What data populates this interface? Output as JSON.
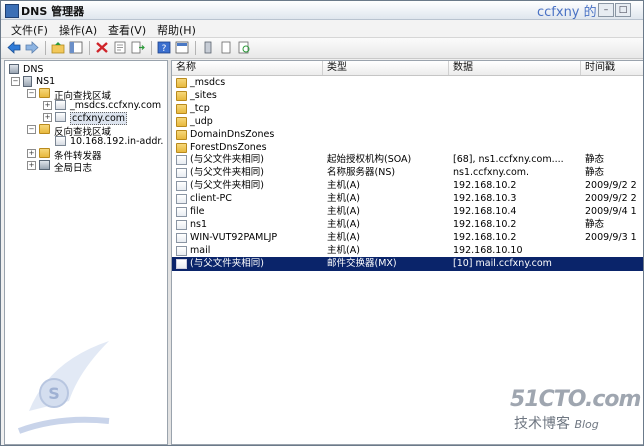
{
  "window": {
    "title": "DNS 管理器",
    "overlay_text": "ccfxny 的"
  },
  "menu": [
    "文件(F)",
    "操作(A)",
    "查看(V)",
    "帮助(H)"
  ],
  "tree": {
    "root": "DNS",
    "server": "NS1",
    "forward_zones": "正向查找区域",
    "msdcs_zone": "_msdcs.ccfxny.com",
    "main_zone": "ccfxny.com",
    "reverse_zones": "反向查找区域",
    "reverse_zone": "10.168.192.in-addr.",
    "forwarders": "条件转发器",
    "global_logs": "全局日志"
  },
  "list": {
    "headers": [
      "名称",
      "类型",
      "数据",
      "时间戳"
    ],
    "rows": [
      {
        "name": "_msdcs",
        "type": "",
        "data": "",
        "time": "",
        "icon": "folder"
      },
      {
        "name": "_sites",
        "type": "",
        "data": "",
        "time": "",
        "icon": "folder"
      },
      {
        "name": "_tcp",
        "type": "",
        "data": "",
        "time": "",
        "icon": "folder"
      },
      {
        "name": "_udp",
        "type": "",
        "data": "",
        "time": "",
        "icon": "folder"
      },
      {
        "name": "DomainDnsZones",
        "type": "",
        "data": "",
        "time": "",
        "icon": "folder"
      },
      {
        "name": "ForestDnsZones",
        "type": "",
        "data": "",
        "time": "",
        "icon": "folder"
      },
      {
        "name": "(与父文件夹相同)",
        "type": "起始授权机构(SOA)",
        "data": "[68], ns1.ccfxny.com....",
        "time": "静态",
        "icon": "record"
      },
      {
        "name": "(与父文件夹相同)",
        "type": "名称服务器(NS)",
        "data": "ns1.ccfxny.com.",
        "time": "静态",
        "icon": "record"
      },
      {
        "name": "(与父文件夹相同)",
        "type": "主机(A)",
        "data": "192.168.10.2",
        "time": "2009/9/2 2",
        "icon": "record"
      },
      {
        "name": "client-PC",
        "type": "主机(A)",
        "data": "192.168.10.3",
        "time": "2009/9/2 2",
        "icon": "record"
      },
      {
        "name": "file",
        "type": "主机(A)",
        "data": "192.168.10.4",
        "time": "2009/9/4 1",
        "icon": "record"
      },
      {
        "name": "ns1",
        "type": "主机(A)",
        "data": "192.168.10.2",
        "time": "静态",
        "icon": "record"
      },
      {
        "name": "WIN-VUT92PAMLJP",
        "type": "主机(A)",
        "data": "192.168.10.2",
        "time": "2009/9/3 1",
        "icon": "record"
      },
      {
        "name": "mail",
        "type": "主机(A)",
        "data": "192.168.10.10",
        "time": "",
        "icon": "record"
      },
      {
        "name": "(与父文件夹相同)",
        "type": "邮件交换器(MX)",
        "data": "[10]  mail.ccfxny.com",
        "time": "",
        "icon": "record",
        "selected": true
      }
    ]
  },
  "watermarks": {
    "site": "51CTO.com",
    "blog": "技术博客",
    "blog_sub": "Blog"
  }
}
